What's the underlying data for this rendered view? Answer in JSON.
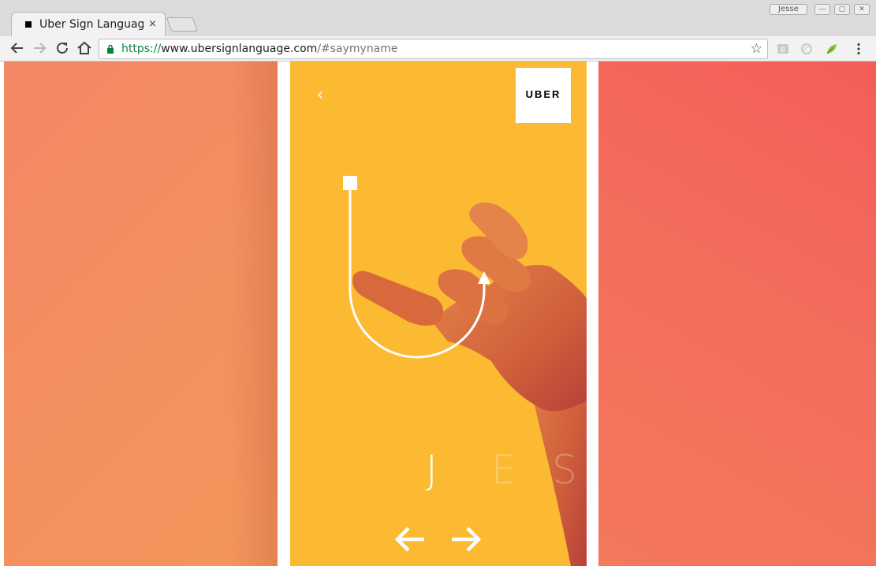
{
  "browser": {
    "tab_title": "Uber Sign Language",
    "tab_close": "×",
    "profile_name": "Jesse",
    "url": {
      "protocol": "https://",
      "host": "www.ubersignlanguage.com",
      "path": "/#saymyname"
    },
    "star": "☆",
    "window_controls": [
      "—",
      "▢",
      "✕"
    ]
  },
  "page": {
    "back_label": "‹",
    "logo_text": "UBER",
    "letters": [
      {
        "char": "J",
        "active": true
      },
      {
        "char": "E",
        "active": false
      },
      {
        "char": "S",
        "active": false
      }
    ],
    "nav": {
      "prev_icon": "left-arrow-icon",
      "next_icon": "right-arrow-icon"
    },
    "colors": {
      "card_background": "#fbba32",
      "left_panel": "#f58f61",
      "right_panel": "#f36a5b",
      "hand_tone": "#d4623a"
    }
  }
}
